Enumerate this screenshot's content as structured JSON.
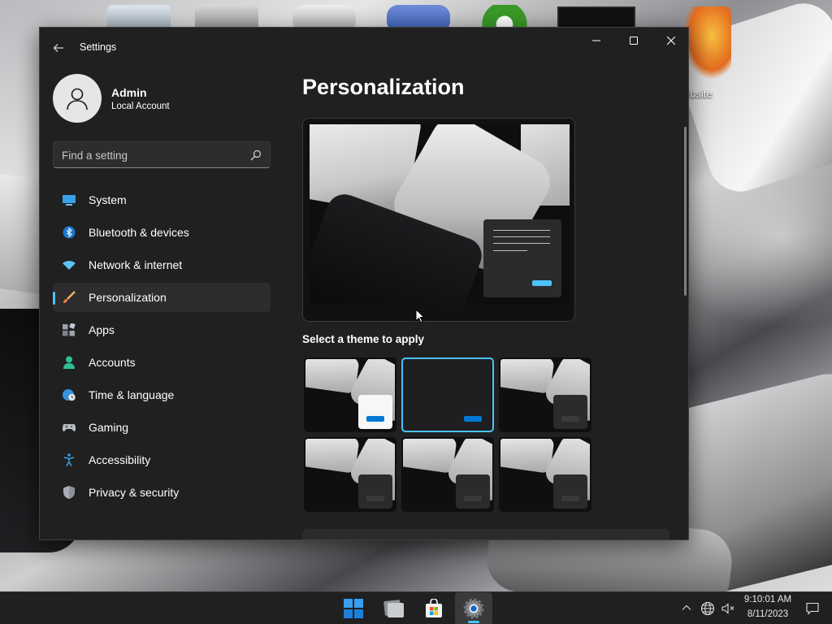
{
  "desktop": {
    "partial_icon_label": "ebsite"
  },
  "window": {
    "app_title": "Settings",
    "back_icon": "back-arrow-icon",
    "controls": [
      "minimize-icon",
      "maximize-icon",
      "close-icon"
    ]
  },
  "user": {
    "name": "Admin",
    "account_type": "Local Account"
  },
  "search": {
    "placeholder": "Find a setting",
    "value": ""
  },
  "sidebar": {
    "items": [
      {
        "label": "System",
        "icon": "system-monitor-icon",
        "active": false
      },
      {
        "label": "Bluetooth & devices",
        "icon": "bluetooth-icon",
        "active": false
      },
      {
        "label": "Network & internet",
        "icon": "wifi-icon",
        "active": false
      },
      {
        "label": "Personalization",
        "icon": "paintbrush-icon",
        "active": true
      },
      {
        "label": "Apps",
        "icon": "apps-icon",
        "active": false
      },
      {
        "label": "Accounts",
        "icon": "person-icon",
        "active": false
      },
      {
        "label": "Time & language",
        "icon": "globe-clock-icon",
        "active": false
      },
      {
        "label": "Gaming",
        "icon": "gamepad-icon",
        "active": false
      },
      {
        "label": "Accessibility",
        "icon": "accessibility-icon",
        "active": false
      },
      {
        "label": "Privacy & security",
        "icon": "shield-icon",
        "active": false
      }
    ]
  },
  "main": {
    "title": "Personalization",
    "section_label": "Select a theme to apply",
    "themes": [
      {
        "window": "light",
        "button": "blue",
        "selected": false
      },
      {
        "window": "dark",
        "button": "blue",
        "selected": true
      },
      {
        "window": "dark",
        "button": "grey",
        "selected": false
      },
      {
        "window": "dark",
        "button": "grey",
        "selected": false
      },
      {
        "window": "dark",
        "button": "grey",
        "selected": false
      },
      {
        "window": "dark",
        "button": "grey",
        "selected": false
      }
    ]
  },
  "taskbar": {
    "apps": [
      "windows-start-icon",
      "file-explorer-icon",
      "microsoft-store-icon",
      "settings-gear-icon"
    ],
    "active_app": "settings-gear-icon",
    "time": "9:10:01 AM",
    "date": "8/11/2023"
  },
  "colors": {
    "accent": "#4cc2ff",
    "accent_dark": "#0078d4",
    "window_bg": "#202020",
    "selected_nav_bg": "#2d2d2d"
  }
}
